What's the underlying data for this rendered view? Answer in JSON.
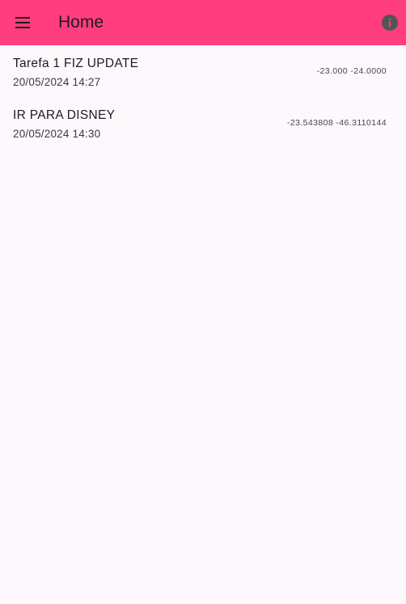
{
  "colors": {
    "app_bar": "#ff3d7f",
    "background": "#fdf8fc",
    "icon": "#1d1b20",
    "info_icon": "#555555"
  },
  "app_bar": {
    "title": "Home",
    "menu_icon": "menu-icon",
    "info_icon": "info-icon"
  },
  "items": [
    {
      "title": "Tarefa 1 FIZ UPDATE",
      "date": "20/05/2024 14:27",
      "coords": "-23.000 -24.0000"
    },
    {
      "title": "IR PARA DISNEY",
      "date": "20/05/2024 14:30",
      "coords": "-23.543808 -46.3110144"
    }
  ]
}
